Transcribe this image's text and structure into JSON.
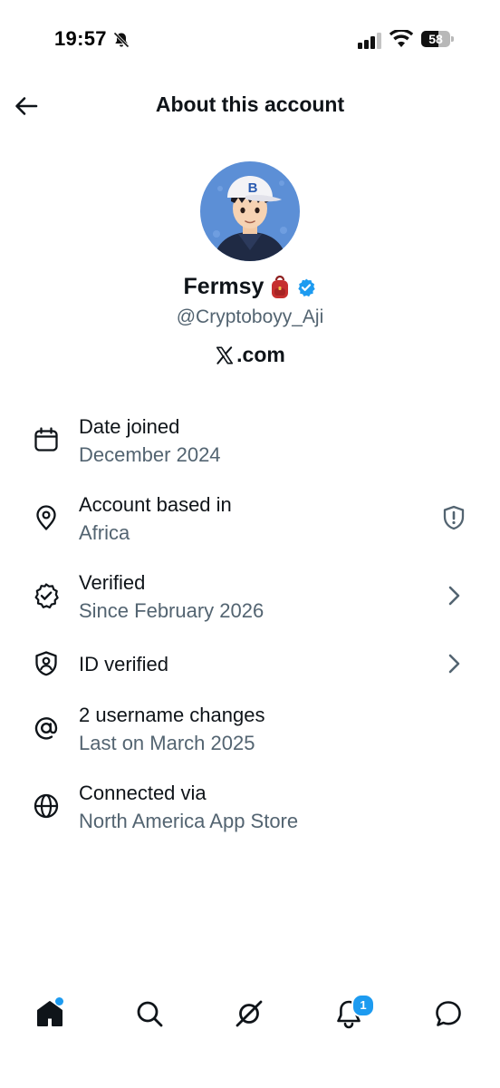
{
  "status_bar": {
    "time": "19:57",
    "battery": "58",
    "battery_level": 0.58
  },
  "header": {
    "title": "About this account"
  },
  "profile": {
    "display_name": "Fermsy",
    "name_emoji": "backpack-emoji",
    "verified": true,
    "handle": "@Cryptoboyy_Aji",
    "source": ".com",
    "cap_letter": "B"
  },
  "info_items": [
    {
      "icon": "calendar-icon",
      "title": "Date joined",
      "subtitle": "December 2024"
    },
    {
      "icon": "location-pin-icon",
      "title": "Account based in",
      "subtitle": "Africa",
      "right_icon": "shield-alert-icon"
    },
    {
      "icon": "verified-badge-icon",
      "title": "Verified",
      "subtitle": "Since February 2026",
      "right_icon": "chevron-right-icon"
    },
    {
      "icon": "id-shield-icon",
      "title": "ID verified",
      "right_icon": "chevron-right-icon"
    },
    {
      "icon": "at-sign-icon",
      "title": "2 username changes",
      "subtitle": "Last on March 2025"
    },
    {
      "icon": "globe-icon",
      "title": "Connected via",
      "subtitle": "North America App Store"
    }
  ],
  "tab_bar": {
    "tabs": [
      "home-icon",
      "search-icon",
      "grok-icon",
      "notifications-icon",
      "messages-icon"
    ],
    "notifications_count": "1"
  },
  "colors": {
    "text_primary": "#0f1419",
    "text_secondary": "#536471",
    "accent": "#1d9bf0"
  }
}
